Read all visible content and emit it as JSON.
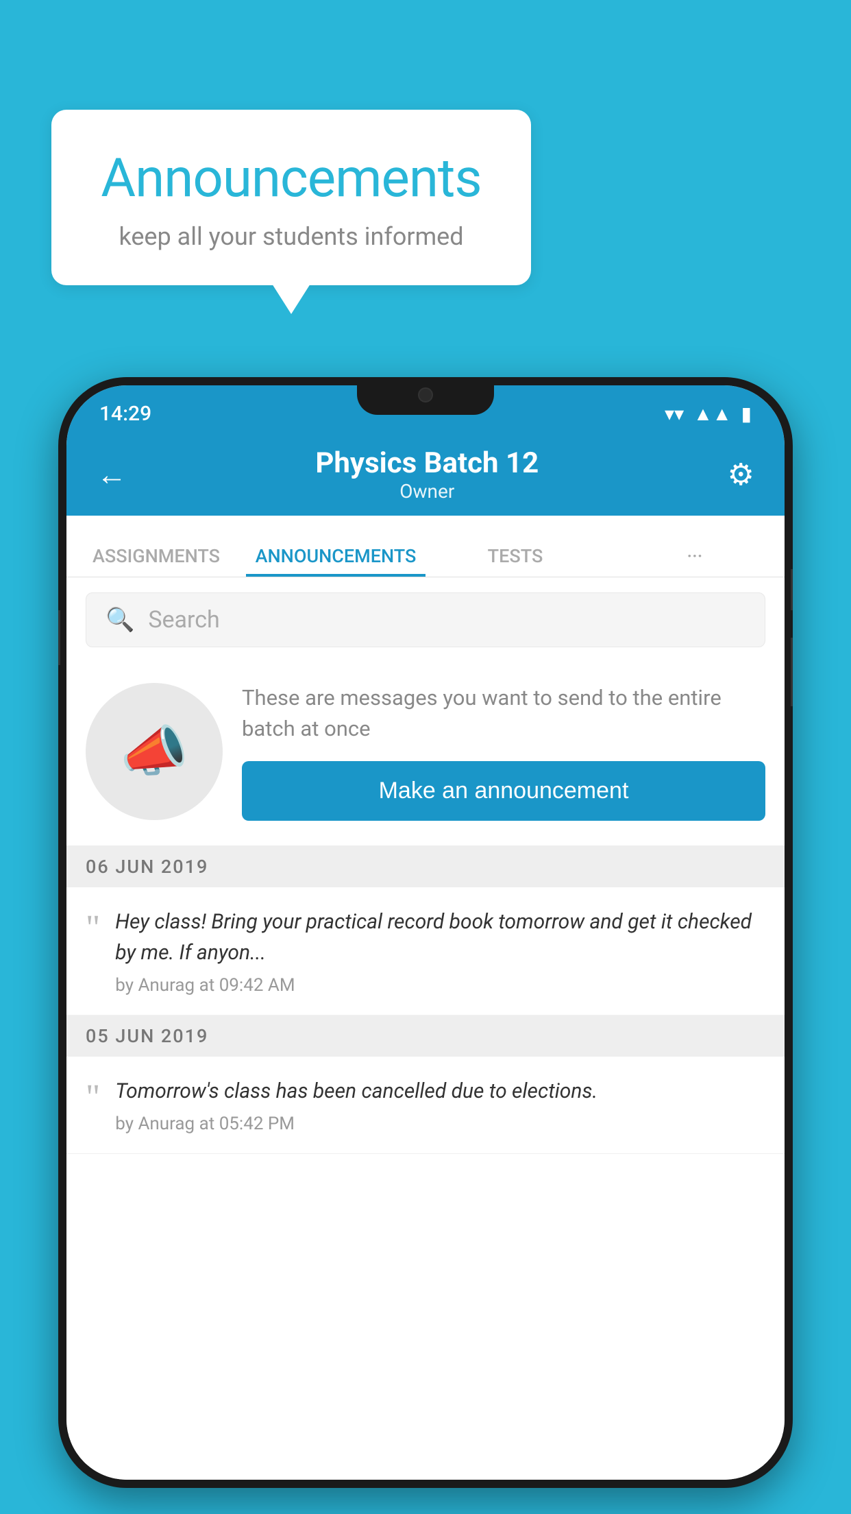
{
  "background_color": "#29b6d8",
  "speech_bubble": {
    "title": "Announcements",
    "subtitle": "keep all your students informed"
  },
  "phone": {
    "status_bar": {
      "time": "14:29",
      "icons": [
        "wifi",
        "signal",
        "battery"
      ]
    },
    "app_bar": {
      "title": "Physics Batch 12",
      "subtitle": "Owner",
      "back_label": "←",
      "settings_label": "⚙"
    },
    "tabs": [
      {
        "label": "ASSIGNMENTS",
        "active": false
      },
      {
        "label": "ANNOUNCEMENTS",
        "active": true
      },
      {
        "label": "TESTS",
        "active": false
      },
      {
        "label": "···",
        "active": false
      }
    ],
    "search": {
      "placeholder": "Search"
    },
    "promo": {
      "text": "These are messages you want to send to the entire batch at once",
      "button_label": "Make an announcement"
    },
    "announcements": [
      {
        "date": "06  JUN  2019",
        "text": "Hey class! Bring your practical record book tomorrow and get it checked by me. If anyon...",
        "meta": "by Anurag at 09:42 AM"
      },
      {
        "date": "05  JUN  2019",
        "text": "Tomorrow's class has been cancelled due to elections.",
        "meta": "by Anurag at 05:42 PM"
      }
    ]
  }
}
